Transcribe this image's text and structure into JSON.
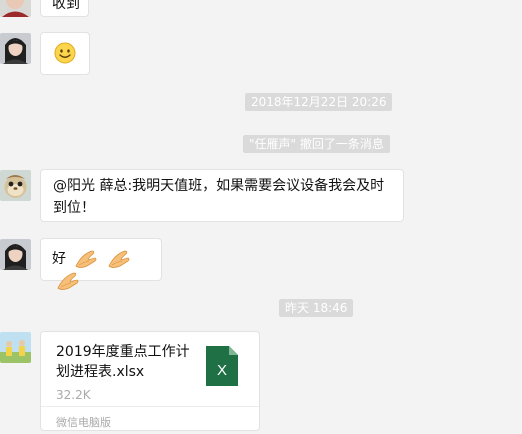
{
  "messages": {
    "m1": {
      "text": "收到"
    },
    "m4": {
      "text": "@阳光 薛总:我明天值班，如果需要会议设备我会及时到位！"
    },
    "m5": {
      "text": "好"
    },
    "file": {
      "name": "2019年度重点工作计划进程表.xlsx",
      "size": "32.2K",
      "source": "微信电脑版",
      "icon_letter": "X"
    }
  },
  "timestamps": {
    "t1": "2018年12月22日 20:26",
    "t2": "昨天 18:46"
  },
  "system": {
    "recall": "\"任雁声\" 撤回了一条消息"
  },
  "icons": {
    "m2": "smile-emoji-icon",
    "m5": "waving-hand-emoji-icon",
    "file": "excel-file-icon"
  },
  "colors": {
    "excel": "#1f7145",
    "timestamp_bg": "#dadada",
    "bubble": "#ffffff"
  }
}
